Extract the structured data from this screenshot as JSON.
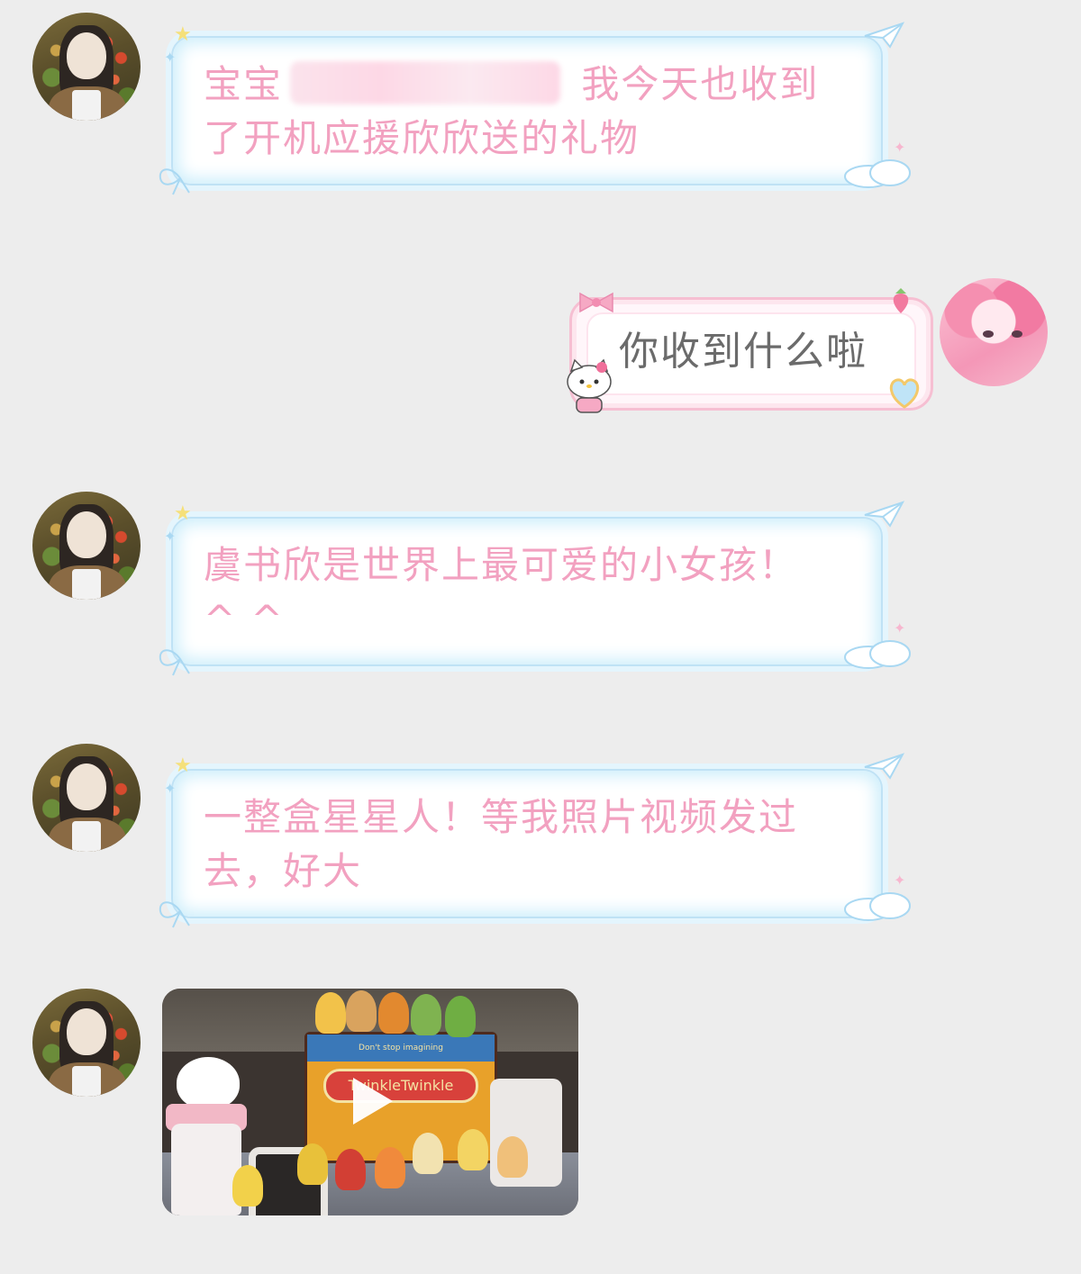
{
  "messages": [
    {
      "side": "left",
      "type": "text",
      "text_before": "宝宝",
      "text_after": " 我今天也收到\n了开机应援欣欣送的礼物"
    },
    {
      "side": "right",
      "type": "text",
      "text": "你收到什么啦"
    },
    {
      "side": "left",
      "type": "text",
      "text": "虞书欣是世界上最可爱的小女孩！\n^ ^"
    },
    {
      "side": "left",
      "type": "text",
      "text": "一整盒星星人！等我照片视频发过\n去，好大"
    },
    {
      "side": "left",
      "type": "video",
      "box_top_text": "Don't stop imagining",
      "box_logo_text": "TwinkleTwinkle"
    }
  ],
  "colors": {
    "background": "#ededed",
    "left_text": "#f2a1c0",
    "left_border": "#bfe2f5",
    "right_text": "#6b6b6b",
    "right_border": "#f6bfd2"
  },
  "icons": {
    "play": "play-icon",
    "plane": "paper-plane-icon",
    "star": "star-icon",
    "ribbon": "ribbon-bow-icon",
    "cloud": "cloud-icon",
    "kitty": "hello-kitty-icon",
    "heart": "heart-icon",
    "strawberry": "strawberry-icon"
  }
}
